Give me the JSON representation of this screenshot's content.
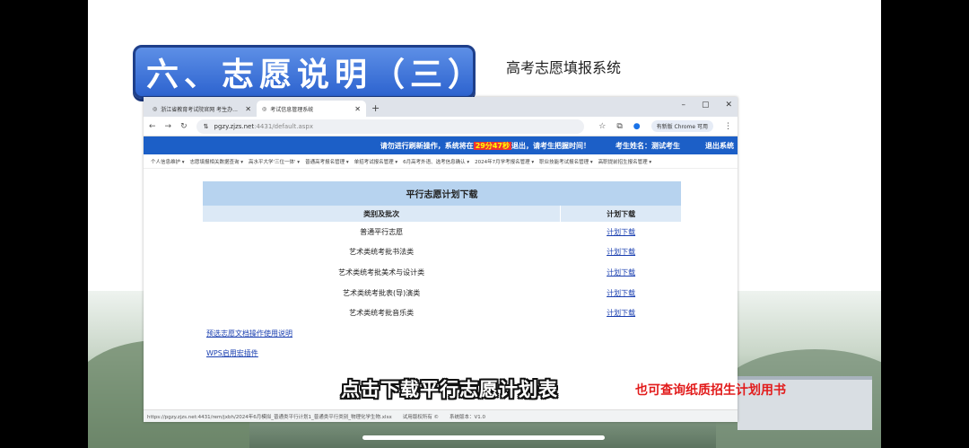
{
  "slide": {
    "heading": "六、志愿说明（三）",
    "system_title": "高考志愿填报系统"
  },
  "browser": {
    "tabs": [
      {
        "label": "浙江省教育考试院官网 考生办..."
      },
      {
        "label": "考试信息管理系统"
      }
    ],
    "new_tab": "+",
    "window_controls": [
      "–",
      "▢",
      "✕"
    ],
    "url_host": "pgzy.zjzs.net",
    "url_rest": ":4431/default.aspx",
    "profile": "有新版 Chrome 可用"
  },
  "page": {
    "warning_prefix": "请勿进行刷新操作，系统将在",
    "warning_time": "29分47秒",
    "warning_suffix": "退出，请考生把握时间！",
    "candidate": "考生姓名：测试考生",
    "logout": "退出系统",
    "menu": [
      "个人信息维护 ▾",
      "志愿填报相关数据查询 ▾",
      "高水平大学'三位一体' ▾",
      "普通高考报名管理 ▾",
      "单招考试报名管理 ▾",
      "6月高考外语、选考信息确认 ▾",
      "2024年7月学考报名管理 ▾",
      "职业技能考试报名管理 ▾",
      "高职提前招生报名管理 ▾"
    ],
    "table": {
      "caption": "平行志愿计划下载",
      "headers": [
        "类别及批次",
        "计划下载"
      ],
      "rows": [
        {
          "category": "普通平行志愿",
          "link": "计划下载"
        },
        {
          "category": "艺术类统考批书法类",
          "link": "计划下载"
        },
        {
          "category": "艺术类统考批美术与设计类",
          "link": "计划下载"
        },
        {
          "category": "艺术类统考批表(导)演类",
          "link": "计划下载"
        },
        {
          "category": "艺术类统考批音乐类",
          "link": "计划下载"
        }
      ]
    },
    "link_guide": "预选志愿文档操作使用说明",
    "link_wps": "WPS启用宏插件",
    "status": [
      "https://pgzy.zjzs.net:4431/rem/jxbh/2024年6月模拟_普通类平行计划1_普通类平行类别_物理化学生物.xlsx",
      "试用版权所有 ©",
      "系统版本：V1.0"
    ]
  },
  "captions": {
    "subtitle": "点击下载平行志愿计划表",
    "side_note": "也可查询纸质招生计划用书"
  }
}
